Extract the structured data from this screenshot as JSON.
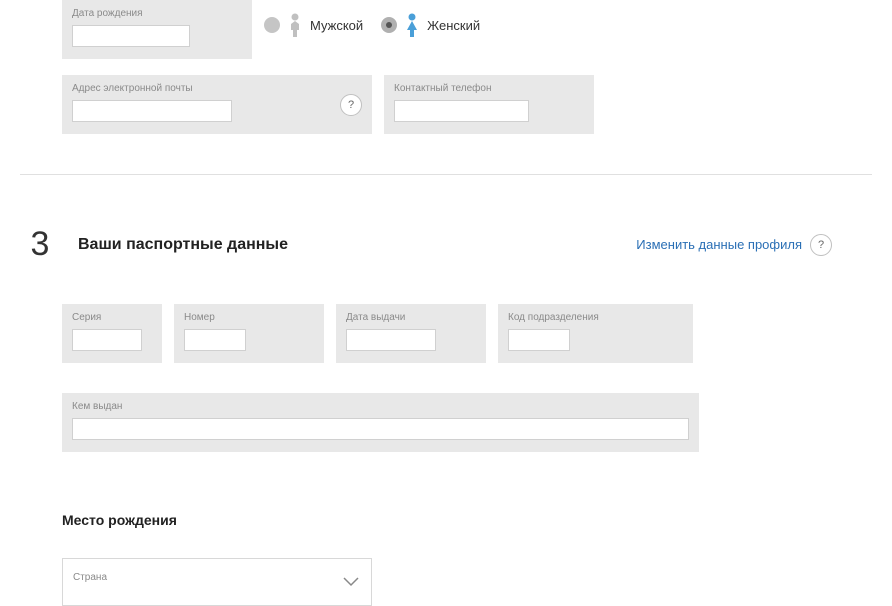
{
  "personal": {
    "dob_label": "Дата рождения",
    "gender_male": "Мужской",
    "gender_female": "Женский",
    "email_label": "Адрес электронной почты",
    "phone_label": "Контактный телефон",
    "help_symbol": "?"
  },
  "passport_section": {
    "step_number": "3",
    "title": "Ваши паспортные данные",
    "change_link": "Изменить данные профиля",
    "help_symbol": "?",
    "series_label": "Серия",
    "number_label": "Номер",
    "issue_date_label": "Дата выдачи",
    "dept_code_label": "Код подразделения",
    "issued_by_label": "Кем выдан"
  },
  "birthplace": {
    "heading": "Место рождения",
    "country_label": "Страна"
  }
}
